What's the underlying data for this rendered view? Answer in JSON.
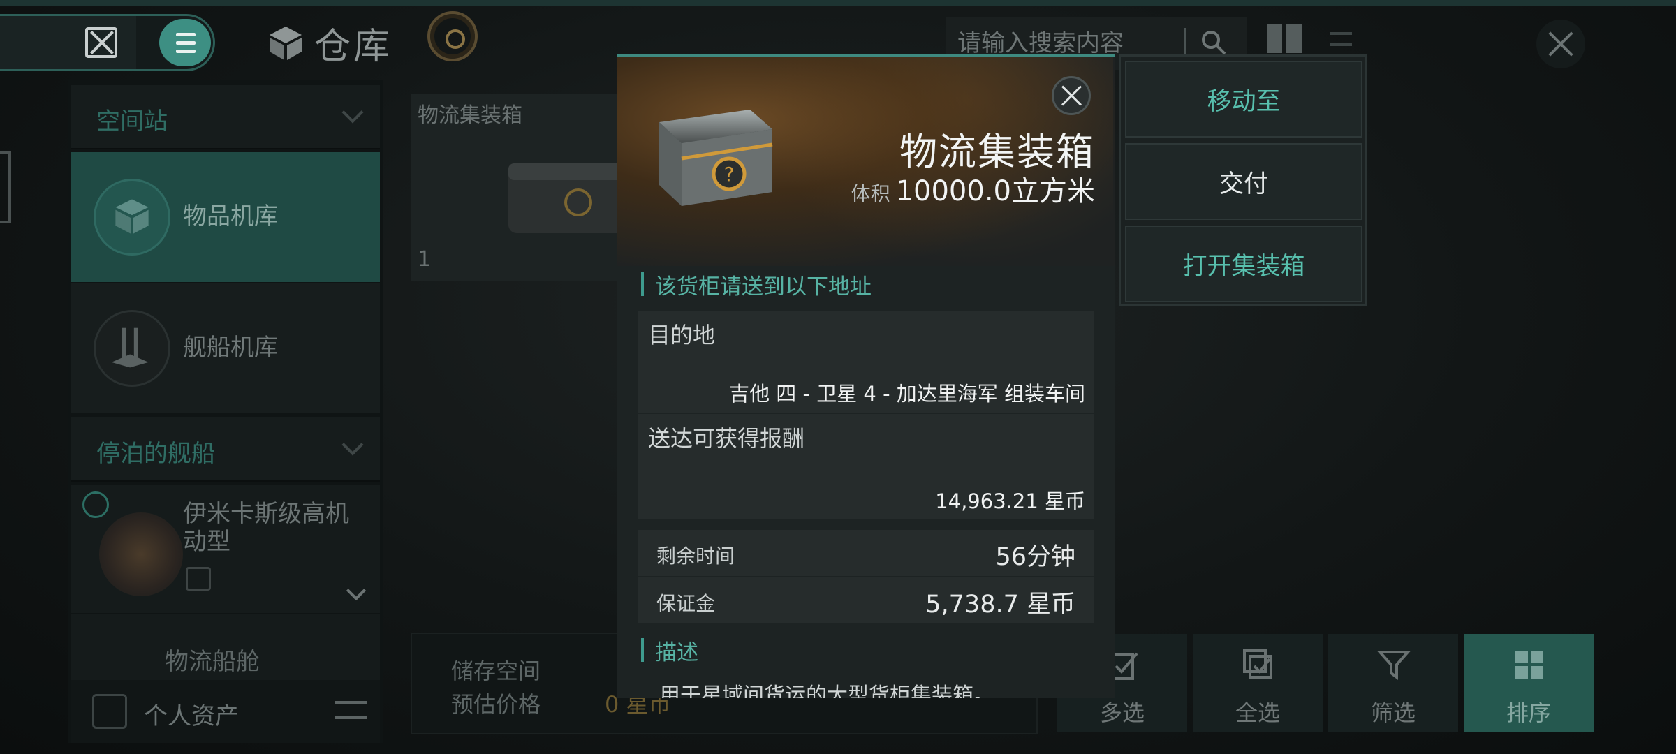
{
  "header": {
    "title": "仓库",
    "search_placeholder": "请输入搜索内容"
  },
  "sidebar": {
    "section_station": "空间站",
    "item_hangar": "物品机库",
    "item_ship_hangar": "舰船机库",
    "section_docked": "停泊的舰船",
    "ship_name": "伊米卡斯级高机动型",
    "cargo_hold": "物流船舱",
    "personal_assets": "个人资产"
  },
  "grid": {
    "card_label": "物流集装箱",
    "card_count": "1"
  },
  "storage": {
    "space_label": "储存空间",
    "price_label": "预估价格",
    "price_value": "0 星币"
  },
  "bottom_buttons": {
    "multi": "多选",
    "all": "全选",
    "filter": "筛选",
    "sort": "排序"
  },
  "popup": {
    "item_name": "物流集装箱",
    "volume_label": "体积",
    "volume_value": "10000.0立方米",
    "address_header": "该货柜请送到以下地址",
    "destination_label": "目的地",
    "destination_value": "吉他 四 - 卫星 4 - 加达里海军 组装车间",
    "reward_label": "送达可获得报酬",
    "reward_value": "14,963.21 星币",
    "time_label": "剩余时间",
    "time_value": "56分钟",
    "deposit_label": "保证金",
    "deposit_value": "5,738.7 星币",
    "desc_header": "描述",
    "desc_text": "用于星域间货运的大型货柜集装箱。"
  },
  "actions": {
    "move": "移动至",
    "deliver": "交付",
    "open": "打开集装箱"
  },
  "colors": {
    "accent": "#3e9b8e",
    "accent_text": "#57b3a4",
    "active_bg": "#25584f"
  }
}
